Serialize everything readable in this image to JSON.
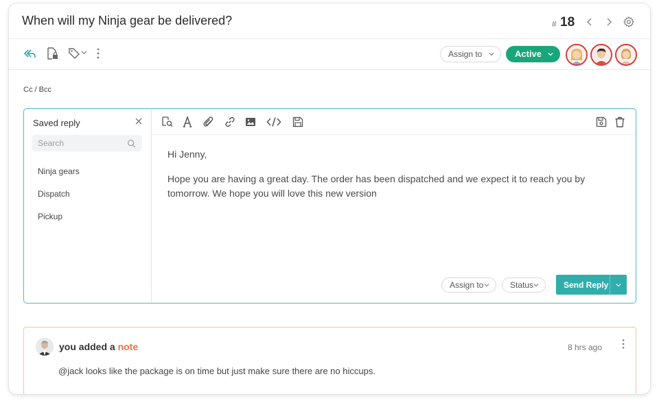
{
  "header": {
    "title": "When will my Ninja gear be delivered?",
    "ticket_hash": "#",
    "ticket_number": "18"
  },
  "toolbar": {
    "assign_to": "Assign to",
    "status_button": "Active",
    "status_color": "#1aa57a"
  },
  "cc_bcc": "Cc / Bcc",
  "saved_reply": {
    "title": "Saved reply",
    "search_placeholder": "Search",
    "items": [
      "Ninja gears",
      "Dispatch",
      "Pickup"
    ]
  },
  "editor": {
    "greeting": "Hi Jenny,",
    "body": "Hope you are having a great day. The order has been dispatched and we expect it to reach you by tomorrow. We hope you will love this new version",
    "assign_to": "Assign to",
    "status": "Status",
    "send_label": "Send Reply"
  },
  "note": {
    "prefix": "you added a ",
    "keyword": "note",
    "time": "8 hrs ago",
    "text": "@jack looks like the package is on time but just make sure there are no hiccups."
  },
  "colors": {
    "accent": "#30aeab",
    "compose_border": "#4cbcc0",
    "note_border": "#f3c3a9",
    "note_keyword": "#f07242",
    "avatar_ring": "#d23a3a"
  }
}
